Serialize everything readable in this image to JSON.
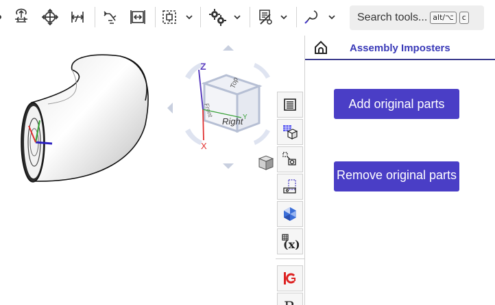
{
  "toolbar": {
    "tools": [
      {
        "icon": "sketch-dot-icon"
      },
      {
        "icon": "assembly-rotate-icon"
      },
      {
        "icon": "transform-icon"
      },
      {
        "icon": "mate-connector-icon"
      },
      {
        "icon": "revolute-mate-icon"
      },
      {
        "icon": "slider-mate-icon"
      },
      {
        "icon": "group-select-icon"
      },
      {
        "icon": "gear-relation-icon"
      },
      {
        "icon": "display-states-icon"
      },
      {
        "icon": "measure-icon"
      }
    ],
    "search": {
      "label": "Search tools...",
      "shortcut_key1": "alt/⌥",
      "shortcut_key2": "c"
    }
  },
  "viewcube": {
    "axis_z": "Z",
    "axis_x": "X",
    "axis_y": "Y",
    "face_right": "Right",
    "face_top": "Top",
    "face_front": "Front"
  },
  "panel": {
    "title": "Assembly Imposters",
    "add_button": "Add original parts",
    "remove_button": "Remove original parts"
  },
  "colors": {
    "accent": "#4a3ec6",
    "title": "#3a3ab8",
    "axis_z": "#5b3fbf",
    "axis_x": "#e03030",
    "axis_y": "#3aa23a"
  }
}
